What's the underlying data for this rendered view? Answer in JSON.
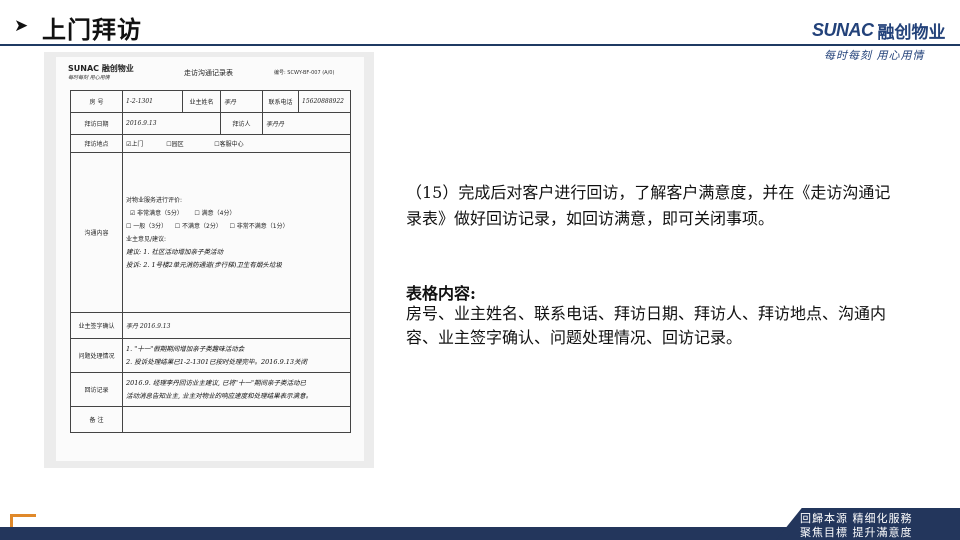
{
  "header": {
    "title": "上门拜访",
    "brand_en": "SUNAC",
    "brand_cn": "融创物业",
    "slogan": "每时每刻 用心用情"
  },
  "form": {
    "brand_en": "SUNAC",
    "brand_cn": "融创物业",
    "slogan": "每时每刻 用心用情",
    "title": "走访沟通记录表",
    "code": "编号: SCWY-BF-007 (A/0)",
    "labels": {
      "room": "房 号",
      "owner_name": "业主姓名",
      "phone": "联系电话",
      "visit_date": "拜访日期",
      "visitor": "拜访人",
      "visit_place": "拜访地点",
      "content": "沟通内容",
      "signature": "业主签字确认",
      "handling": "问题处理情况",
      "callback": "回访记录",
      "remarks": "备 注"
    },
    "values": {
      "room": "1-2-1301",
      "owner_name": "李丹",
      "phone": "15620888922",
      "visit_date": "2016.9.13",
      "visitor": "李丹丹",
      "signature": "李丹 2016.9.13"
    },
    "place_options": [
      "☑上门",
      "☐园区",
      "☐客服中心"
    ],
    "content": {
      "eval_title": "对物业服务进行评价:",
      "rating_row1": [
        "☑ 非常满意（5分）",
        "☐ 满意（4分）"
      ],
      "rating_row2": [
        "☐ 一般（3分）",
        "☐ 不满意（2分）",
        "☐ 非常不满意（1分）"
      ],
      "opinion_title": "业主意见/建议:",
      "hw1": "建议: 1. 社区活动增加亲子类活动",
      "hw2": "投诉: 2. 1号楼2单元消防通道(步行梯)卫生有烟头垃圾"
    },
    "handling": {
      "hw1": "1. \"十一\"假期期间增加亲子类趣味活动会",
      "hw2": "2. 投诉处理结果已1-2-1301已按时处理完毕。2016.9.13关闭"
    },
    "callback": {
      "hw1": "2016.9.  经理李丹回访业主建议, 已将\"十一\"期间亲子类活动已",
      "hw2": "活动消息告知业主, 业主对物业的响应速度和处理结果表示满意。"
    }
  },
  "description": {
    "para": "（15）完成后对客户进行回访，了解客户满意度，并在《走访沟通记录表》做好回访记录，如回访满意，即可关闭事项。",
    "subheading": "表格内容:",
    "items": "房号、业主姓名、联系电话、拜访日期、拜访人、拜访地点、沟通内容、业主签字确认、问题处理情况、回访记录。"
  },
  "footer": {
    "line1": "回歸本源 精细化服務",
    "line2": "聚焦目標 提升滿意度"
  },
  "colors": {
    "navy": "#23365c",
    "brand_blue": "#23427a",
    "accent_orange": "#e0892a"
  }
}
